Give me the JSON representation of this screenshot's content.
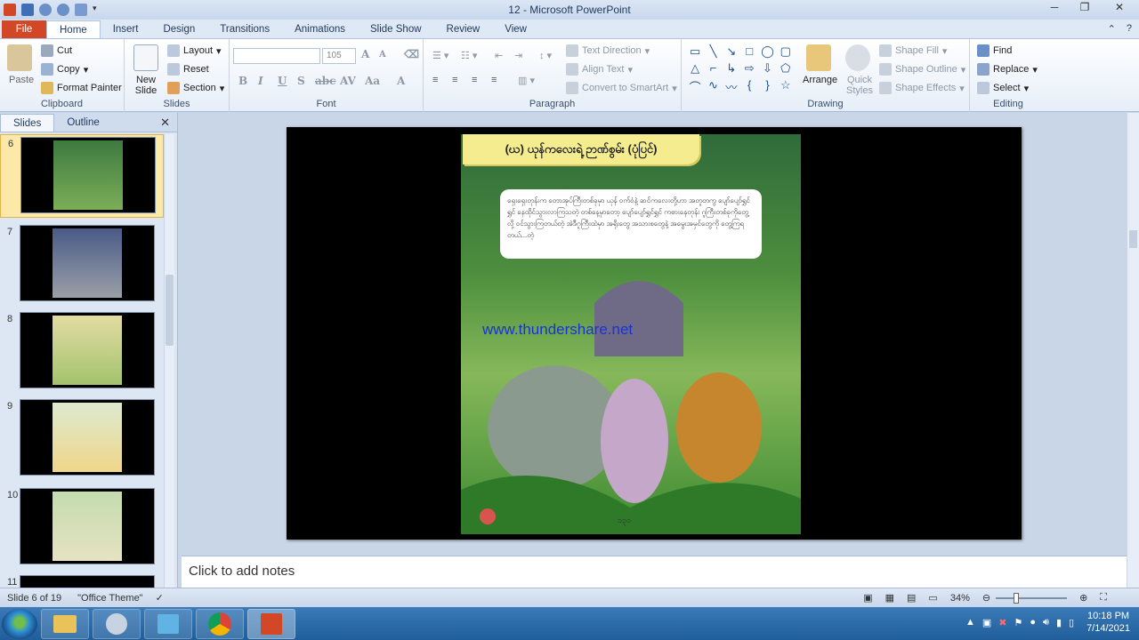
{
  "window": {
    "title": "12 - Microsoft PowerPoint"
  },
  "tabs": [
    "File",
    "Home",
    "Insert",
    "Design",
    "Transitions",
    "Animations",
    "Slide Show",
    "Review",
    "View"
  ],
  "active_tab": "Home",
  "clipboard": {
    "paste": "Paste",
    "cut": "Cut",
    "copy": "Copy",
    "format_painter": "Format Painter",
    "label": "Clipboard"
  },
  "slides_group": {
    "new_slide": "New Slide",
    "layout": "Layout",
    "reset": "Reset",
    "section": "Section",
    "label": "Slides"
  },
  "font": {
    "name": "",
    "size": "105",
    "label": "Font"
  },
  "paragraph": {
    "text_direction": "Text Direction",
    "align_text": "Align Text",
    "convert_smartart": "Convert to SmartArt",
    "label": "Paragraph"
  },
  "drawing": {
    "arrange": "Arrange",
    "quick_styles": "Quick Styles",
    "shape_fill": "Shape Fill",
    "shape_outline": "Shape Outline",
    "shape_effects": "Shape Effects",
    "label": "Drawing"
  },
  "editing": {
    "find": "Find",
    "replace": "Replace",
    "select": "Select",
    "label": "Editing"
  },
  "panel": {
    "tab_slides": "Slides",
    "tab_outline": "Outline"
  },
  "thumbnails": [
    {
      "num": "6"
    },
    {
      "num": "7"
    },
    {
      "num": "8"
    },
    {
      "num": "9"
    },
    {
      "num": "10"
    },
    {
      "num": "11"
    }
  ],
  "slide": {
    "heading": "(ဃ) ယုန်ကလေးရဲ့ ဉာဏ်စွမ်း (ပုံပြင်)",
    "story": "ရှေးရှေးတုန်းက တောအုပ်ကြီးတစ်ခုမှာ ယုန် ဝက်ဝံနဲ့ ဆင်ကလေးတို့ဟာ အတူတကွ ပျော်ပျော်ရွှင်ရွှင် နေထိုင်သွားလာကြသတဲ့ တစ်နေ့မှာတော့ ပျော်ပျော်ရွှင်ရွှင် ကစားနေတုန်း ဂူကြီးတစ်ခုကိုတွေ့လို့ ဝင်သွားကြတယ်တဲ့ အဲဒီဂူကြီးထဲမှာ အရိုးတွေ အသားစတွေနဲ့ အမွေးအမှင်တွေကို တွေ့ကြရတယ်...တဲ့",
    "watermark": "www.thundershare.net",
    "page_number": "၁၃၀"
  },
  "notes": {
    "placeholder": "Click to add notes"
  },
  "status": {
    "slide_info": "Slide 6 of 19",
    "theme": "\"Office Theme\"",
    "zoom": "34%"
  },
  "taskbar": {
    "time": "10:18 PM",
    "date": "7/14/2021"
  },
  "colors": {
    "file_tab": "#d24726",
    "ribbon_bg": "#e6eef8",
    "taskbar": "#1f5e9a",
    "selected_thumb": "#fce9a8"
  }
}
